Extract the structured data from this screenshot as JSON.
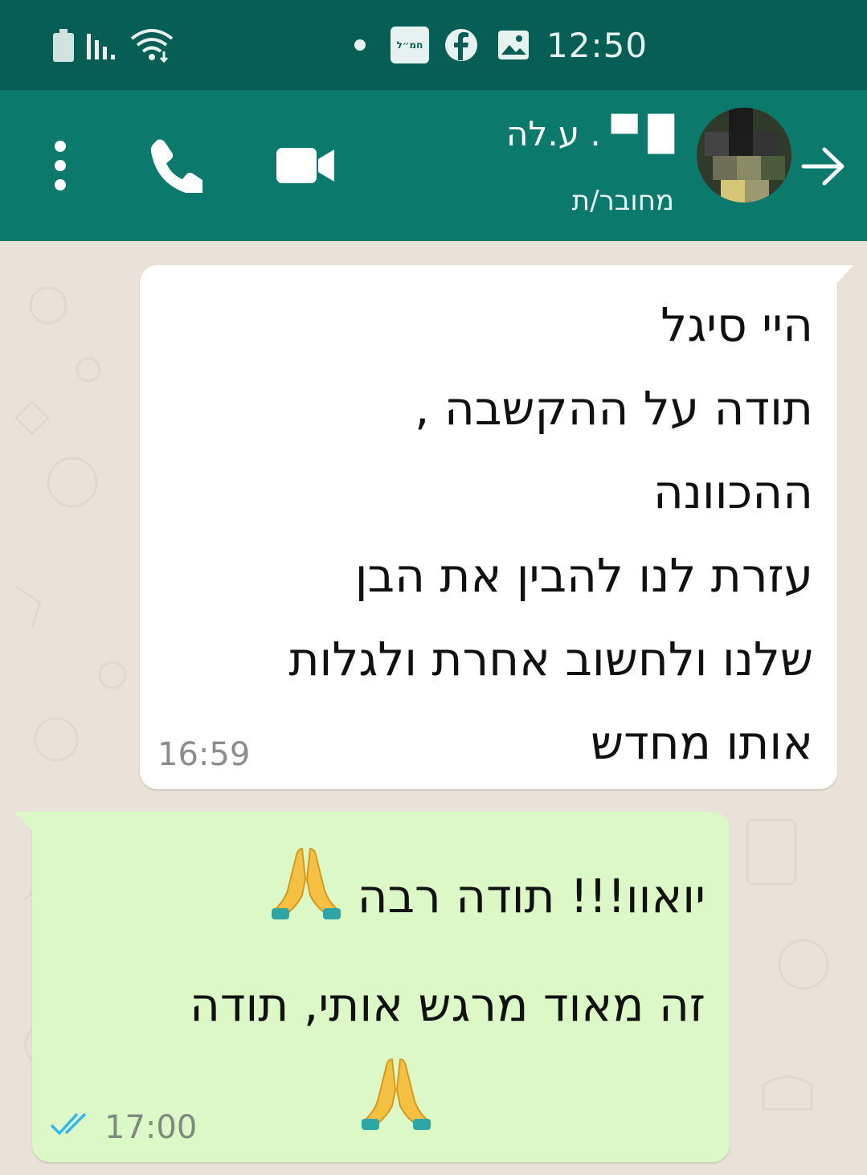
{
  "status_bar": {
    "time": "12:50",
    "badge_text": "חמ״ל",
    "icons": [
      "battery-icon",
      "signal-icon",
      "wifi-icon",
      "dot-icon",
      "badge-app-icon",
      "facebook-icon",
      "gallery-icon"
    ]
  },
  "header": {
    "contact_name": "█  ▀ .  ע.לה",
    "contact_status": "מחובר/ת",
    "icons": [
      "menu-icon",
      "phone-icon",
      "video-icon",
      "back-arrow-icon"
    ]
  },
  "messages": [
    {
      "direction": "incoming",
      "text": "היי סיגל\nתודה על ההקשבה ,\nההכוונה\nעזרת לנו להבין את הבן\nשלנו ולחשוב אחרת ולגלות\nאותו מחדש",
      "time": "16:59"
    },
    {
      "direction": "outgoing",
      "line1": "יואוו!!! תודה רבה",
      "line2": "זה מאוד מרגש אותי, תודה",
      "emoji": "🙏",
      "time": "17:00",
      "status": "read"
    }
  ],
  "colors": {
    "status_bar": "#075e54",
    "header": "#0b7a6c",
    "chat_bg": "#e9e2d8",
    "incoming_bubble": "#ffffff",
    "outgoing_bubble": "#dcf8c6",
    "read_ticks": "#34b7f1"
  }
}
